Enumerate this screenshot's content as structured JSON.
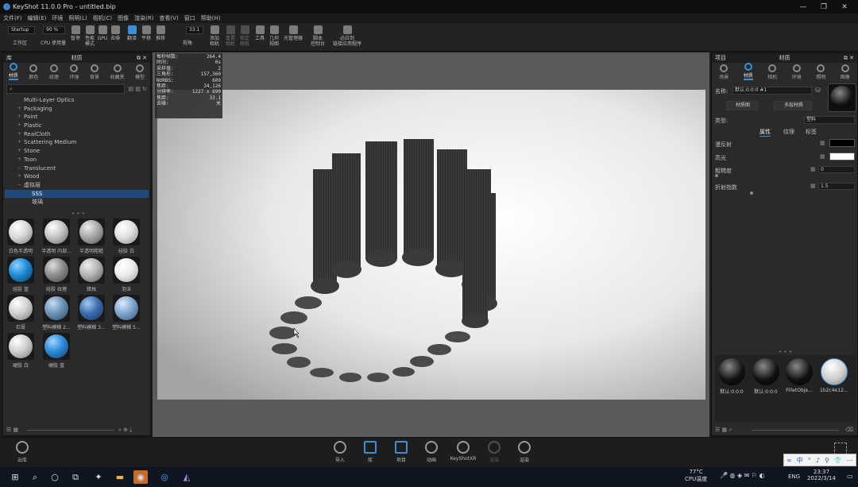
{
  "window": {
    "title": "KeyShot 11.0.0 Pro - untitled.bip",
    "controls": [
      "—",
      "❐",
      "✕"
    ]
  },
  "menu": [
    "文件(F)",
    "编辑(E)",
    "环境",
    "照明(L)",
    "相机(C)",
    "图像",
    "渲染(R)",
    "查看(V)",
    "窗口",
    "帮助(H)"
  ],
  "toolbar": {
    "workspace": "Startup",
    "workspace_label": "工作区",
    "cpu_percent": "90 %",
    "cpu_label": "CPU 使用量",
    "pause": "暂停",
    "perf_mode": "性能\n模式",
    "gpu": "GPU",
    "denoise": "去噪",
    "translate": "翻译",
    "pan": "平移",
    "dolly": "推移",
    "zoom_value": "33.1",
    "view_angle": "视角",
    "add_camera": "添加\n相机",
    "reset_camera": "重置\n相机",
    "lock_camera": "锁定\n相机",
    "tools": "工具",
    "geometry_view": "几何\n视图",
    "light_manager": "光管理器",
    "script_console": "脚本\n控制台",
    "link_app": "必应到\n链接应用程序"
  },
  "library": {
    "header": "库",
    "title": "材质",
    "tabs": [
      "材质",
      "颜色",
      "纹理",
      "环境",
      "背景",
      "收藏夹",
      "模型"
    ],
    "active_tab": 0,
    "tree": [
      "Multi-Layer Optics",
      "Packaging",
      "Paint",
      "Plastic",
      "RealCloth",
      "Scattering Medium",
      "Stone",
      "Toon",
      "Translucent",
      "Wood",
      "虚拟层",
      "SSS",
      "玻璃"
    ],
    "materials": [
      {
        "label": "白色半透明",
        "color": "#d8d8d8"
      },
      {
        "label": "半透明 内部...",
        "color": "#c4c4c4"
      },
      {
        "label": "半透明粗糙",
        "color": "#a8a8a8"
      },
      {
        "label": "硅胶 白",
        "color": "#e0e0e0"
      },
      {
        "label": "硅胶 蓝",
        "color": "#1e8ad6"
      },
      {
        "label": "硅胶 纹理",
        "color": "#8c8c8c"
      },
      {
        "label": "蜡烛",
        "color": "#b4b4b4"
      },
      {
        "label": "泡沫",
        "color": "#ececec"
      },
      {
        "label": "石膏",
        "color": "#d0d0d0"
      },
      {
        "label": "塑料模糊 2...",
        "color": "#6d93b5"
      },
      {
        "label": "塑料模糊 3...",
        "color": "#3b6fb0"
      },
      {
        "label": "塑料模糊 5...",
        "color": "#7ea6cf"
      },
      {
        "label": "硬胶 白",
        "color": "#cfcfcf"
      },
      {
        "label": "硬胶 蓝",
        "color": "#2d8bd8"
      }
    ]
  },
  "stats": [
    [
      "每秒帧数:",
      "264.4"
    ],
    [
      "时间:",
      "0s"
    ],
    [
      "采样值:",
      "2"
    ],
    [
      "三角形:",
      "157,360"
    ],
    [
      "NURBS:",
      "609"
    ],
    [
      "焦距:",
      "24,126"
    ],
    [
      "分辨率:",
      "1227 x 690"
    ],
    [
      "焦距:",
      "33.1"
    ],
    [
      "去噪:",
      "关"
    ]
  ],
  "project": {
    "header": "项目",
    "title": "材质",
    "tabs": [
      "场景",
      "材质",
      "相机",
      "环境",
      "照明",
      "图像"
    ],
    "active_tab": 1,
    "name_label": "名称:",
    "name_value": "默认:0:0:0 #1",
    "material_graph": "材质图",
    "multi_layer": "多层材质",
    "type_label": "类型:",
    "type_value": "塑料",
    "subtabs": [
      "属性",
      "纹理",
      "标签"
    ],
    "props": [
      {
        "label": "漫反射"
      },
      {
        "label": "高光"
      },
      {
        "label": "粗糙度",
        "value": "0"
      },
      {
        "label": "折射指数",
        "value": "1.5"
      }
    ],
    "diffuse_color": "#000000",
    "specular_color": "#ffffff",
    "scene_materials": [
      "默认:0:0:0",
      "默认:0:0:0",
      "FilletObje...",
      "1b2c4e12..."
    ]
  },
  "bottom": [
    {
      "label": "导入"
    },
    {
      "label": "库"
    },
    {
      "label": "项目"
    },
    {
      "label": "动画"
    },
    {
      "label": "KeyShotXR"
    },
    {
      "label": "渲染"
    },
    {
      "label": "渲染"
    }
  ],
  "cloud": "云库",
  "taskbar": {
    "temp": "77°C",
    "temp_label": "CPU温度",
    "lang": "ENG",
    "time": "23:37",
    "date": "2022/3/14"
  },
  "ime": [
    "∞",
    "中",
    "°",
    "♪",
    "⚲",
    "👕",
    "⋯"
  ]
}
